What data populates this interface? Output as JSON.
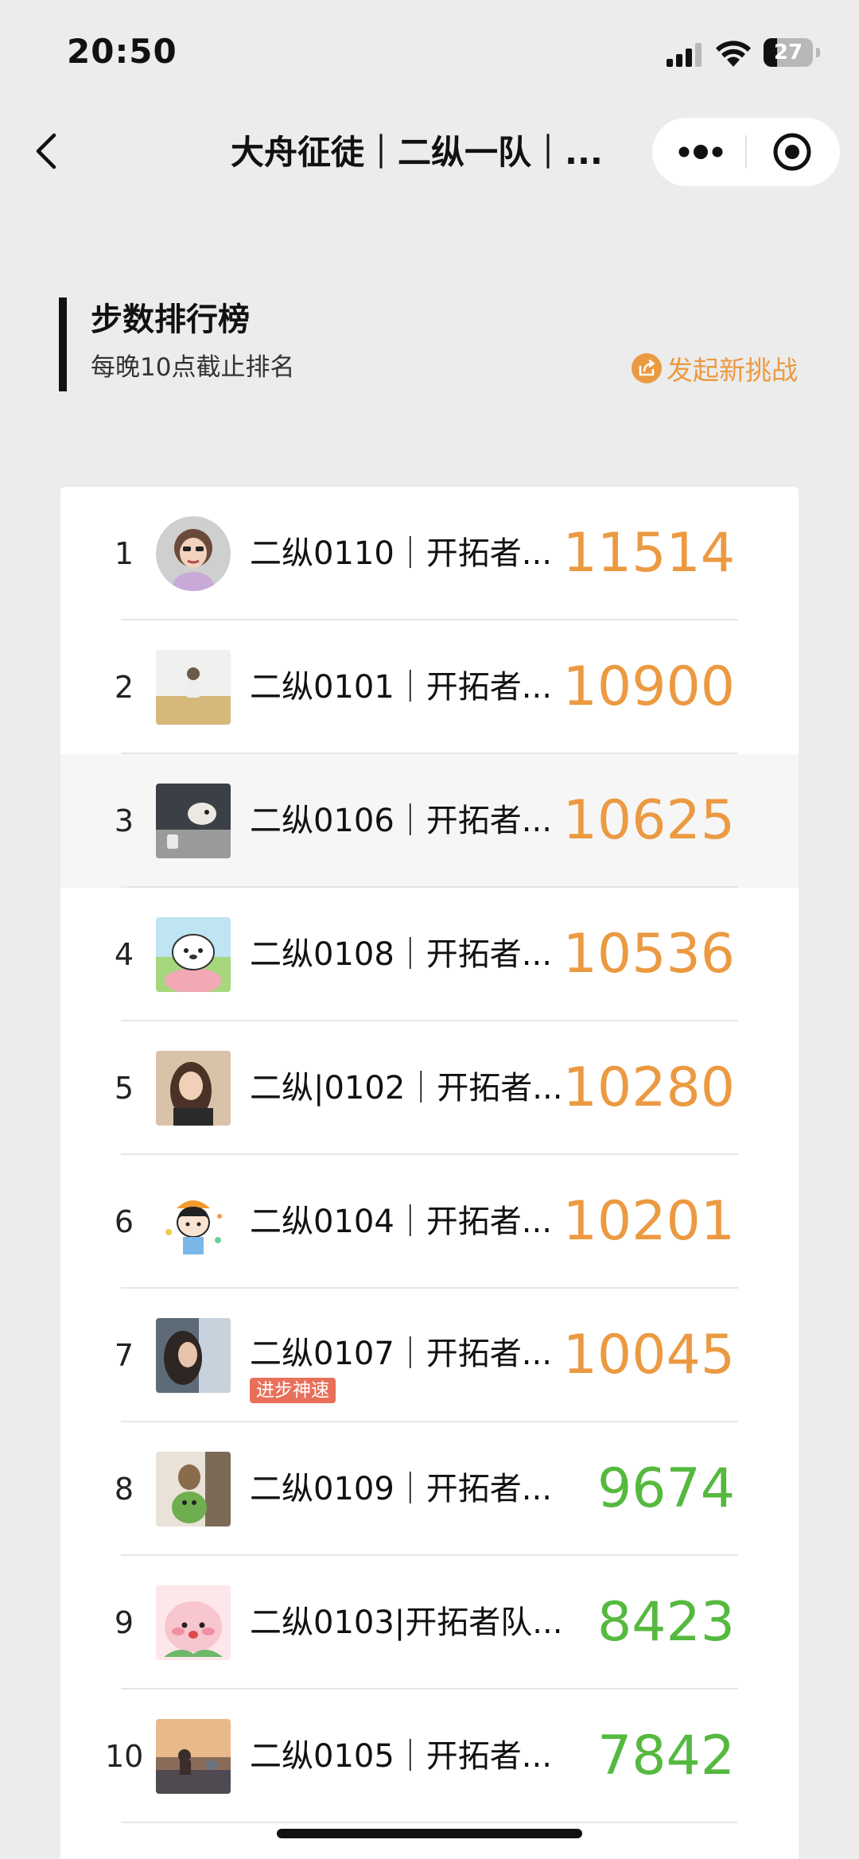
{
  "status_bar": {
    "time": "20:50",
    "battery": "27",
    "battery_level": 0.27
  },
  "nav": {
    "title": "大舟征徒｜二纵一队｜...",
    "more_icon": "more-dots-icon",
    "close_icon": "target-circle-icon"
  },
  "header": {
    "title": "步数排行榜",
    "subtitle": "每晚10点截止排名",
    "challenge_label": "发起新挑战",
    "challenge_icon": "share-out-icon",
    "accent_color": "#eb9a42"
  },
  "colors": {
    "steps_high": "#eb9a42",
    "steps_low": "#55b93f",
    "badge": "#e8705a"
  },
  "ranking": [
    {
      "rank": "1",
      "name": "二纵0110｜开拓者...",
      "steps": "11514",
      "tier": "high",
      "avatar": "cartoon-girl-avatar"
    },
    {
      "rank": "2",
      "name": "二纵0101｜开拓者...",
      "steps": "10900",
      "tier": "high",
      "avatar": "photo-avatar"
    },
    {
      "rank": "3",
      "name": "二纵0106｜开拓者...",
      "steps": "10625",
      "tier": "high",
      "avatar": "dog-photo-avatar"
    },
    {
      "rank": "4",
      "name": "二纵0108｜开拓者...",
      "steps": "10536",
      "tier": "high",
      "avatar": "cartoon-bear-avatar"
    },
    {
      "rank": "5",
      "name": "二纵|0102｜开拓者...",
      "steps": "10280",
      "tier": "high",
      "avatar": "portrait-avatar"
    },
    {
      "rank": "6",
      "name": "二纵0104｜开拓者...",
      "steps": "10201",
      "tier": "high",
      "avatar": "cartoon-kid-avatar"
    },
    {
      "rank": "7",
      "name": "二纵0107｜开拓者...",
      "steps": "10045",
      "tier": "high",
      "avatar": "portrait-avatar",
      "badge": "进步神速"
    },
    {
      "rank": "8",
      "name": "二纵0109｜开拓者...",
      "steps": "9674",
      "tier": "low",
      "avatar": "toy-photo-avatar"
    },
    {
      "rank": "9",
      "name": "二纵0103|开拓者队...",
      "steps": "8423",
      "tier": "low",
      "avatar": "cartoon-peach-avatar"
    },
    {
      "rank": "10",
      "name": "二纵0105｜开拓者...",
      "steps": "7842",
      "tier": "low",
      "avatar": "landscape-avatar"
    }
  ]
}
